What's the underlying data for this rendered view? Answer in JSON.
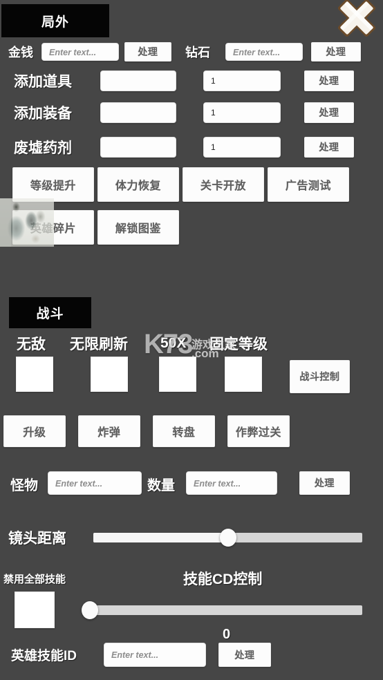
{
  "window": {
    "background_color": "#464646",
    "close_icon": "close-x-icon"
  },
  "sections": {
    "outside": {
      "title": "局外"
    },
    "battle": {
      "title": "战斗"
    }
  },
  "common": {
    "placeholder": "Enter text...",
    "process_label": "处理",
    "qty_default": "1"
  },
  "currency_rows": [
    {
      "label": "金钱",
      "value": "",
      "placeholder": "Enter text...",
      "action": "处理"
    },
    {
      "label": "钻石",
      "value": "",
      "placeholder": "Enter text...",
      "action": "处理"
    }
  ],
  "add_rows": [
    {
      "label": "添加道具",
      "id_value": "",
      "id_placeholder": "Enter text...",
      "qty_value": "1",
      "action": "处理"
    },
    {
      "label": "添加装备",
      "id_value": "",
      "id_placeholder": "Enter text...",
      "qty_value": "1",
      "action": "处理"
    },
    {
      "label": "废墟药剂",
      "id_value": "",
      "id_placeholder": "Enter text...",
      "qty_value": "1",
      "action": "处理"
    }
  ],
  "outside_buttons_row1": [
    {
      "label": "等级提升"
    },
    {
      "label": "体力恢复"
    },
    {
      "label": "关卡开放"
    },
    {
      "label": "广告测试"
    }
  ],
  "outside_buttons_row2": [
    {
      "label": "英雄碎片"
    },
    {
      "label": "解锁图鉴"
    }
  ],
  "battle_toggles": [
    {
      "label": "无敌",
      "checked": false
    },
    {
      "label": "无限刷新",
      "checked": false
    },
    {
      "label": "50X",
      "checked": false
    },
    {
      "label": "固定等级",
      "checked": false
    }
  ],
  "battle_control_button": {
    "label": "战斗控制"
  },
  "battle_buttons": [
    {
      "label": "升级"
    },
    {
      "label": "炸弹"
    },
    {
      "label": "转盘"
    },
    {
      "label": "作弊过关"
    }
  ],
  "monster_row": {
    "name_label": "怪物",
    "name_value": "",
    "name_placeholder": "Enter text...",
    "count_label": "数量",
    "count_value": "",
    "count_placeholder": "Enter text...",
    "action": "处理"
  },
  "camera_slider": {
    "label": "镜头距离",
    "percent": 50
  },
  "skill_section": {
    "disable_all_label": "禁用全部技能",
    "disable_all_checked": false,
    "cd_title": "技能CD控制",
    "cd_percent": 0,
    "cd_value": "0"
  },
  "hero_skill_row": {
    "label": "英雄技能ID",
    "value": "",
    "placeholder": "Enter text...",
    "action": "处理"
  },
  "watermark": {
    "brand": "K73",
    "sub": "游戏之家",
    "domain": ".com"
  }
}
